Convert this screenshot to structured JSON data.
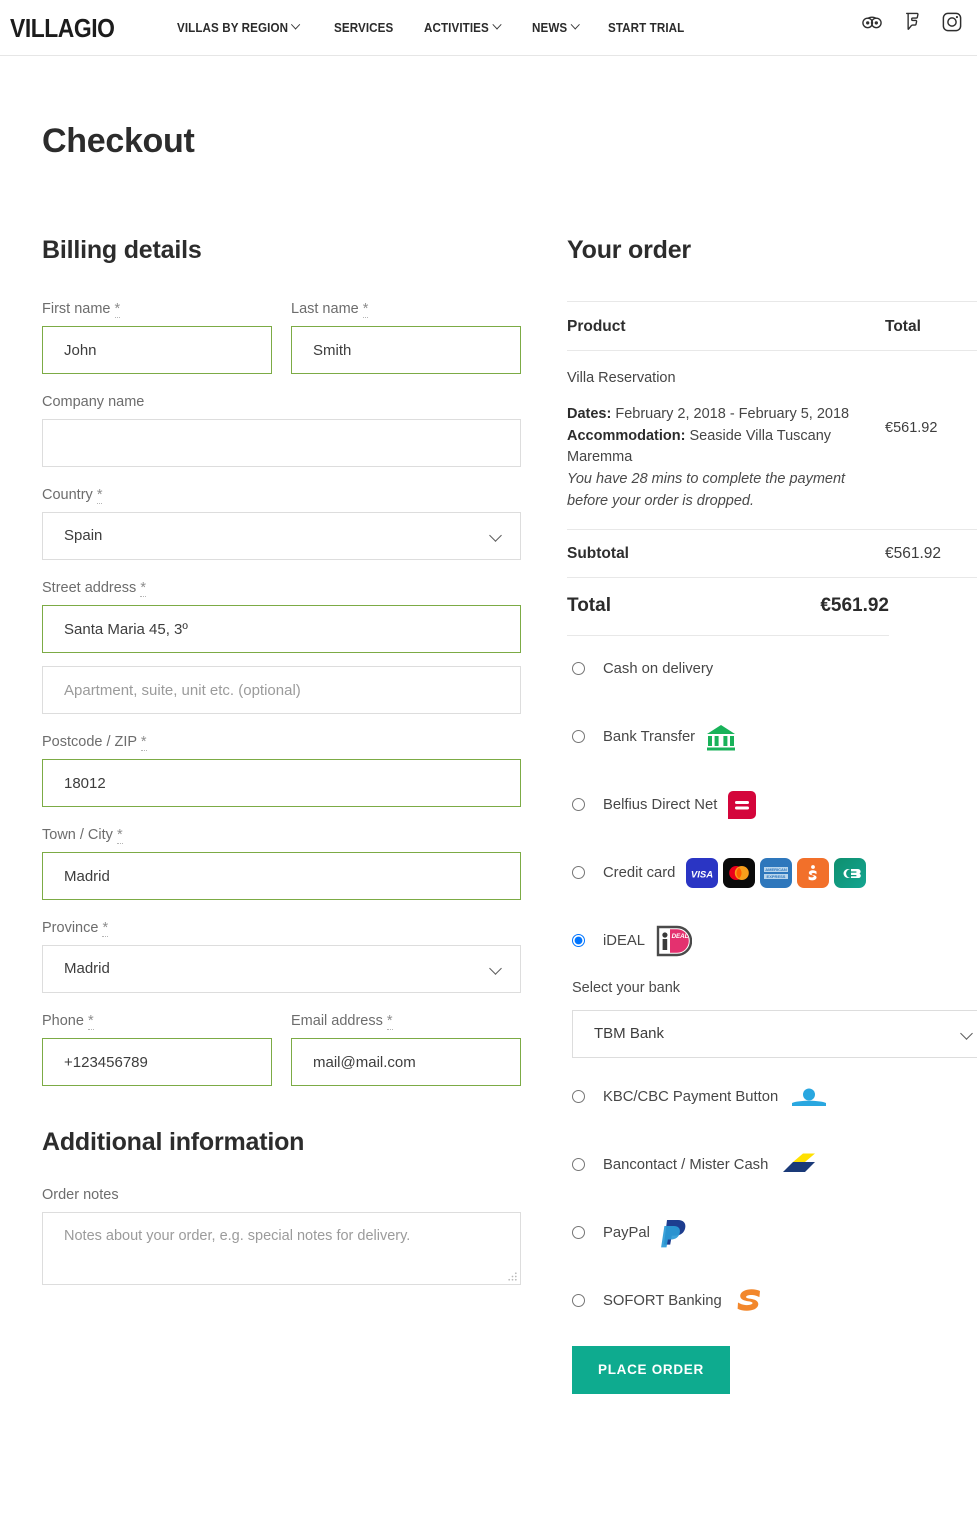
{
  "header": {
    "brand": "VILLAGIO",
    "nav": [
      {
        "label": "VILLAS BY REGION",
        "has_caret": true
      },
      {
        "label": "SERVICES",
        "has_caret": false
      },
      {
        "label": "ACTIVITIES",
        "has_caret": true
      },
      {
        "label": "NEWS",
        "has_caret": true
      },
      {
        "label": "START TRIAL",
        "has_caret": false
      }
    ],
    "social": [
      {
        "name": "tripadvisor-icon"
      },
      {
        "name": "foursquare-icon"
      },
      {
        "name": "instagram-icon"
      }
    ]
  },
  "page": {
    "title": "Checkout"
  },
  "billing": {
    "heading": "Billing details",
    "first_name": {
      "label": "First name",
      "required": "*",
      "value": "John",
      "placeholder": ""
    },
    "last_name": {
      "label": "Last name",
      "required": "*",
      "value": "Smith",
      "placeholder": ""
    },
    "company": {
      "label": "Company name",
      "required": "",
      "value": "",
      "placeholder": ""
    },
    "country": {
      "label": "Country",
      "required": "*",
      "value": "Spain"
    },
    "street": {
      "label": "Street address",
      "required": "*",
      "value": "Santa Maria 45, 3º",
      "placeholder": ""
    },
    "street2": {
      "label": "",
      "required": "",
      "value": "",
      "placeholder": "Apartment, suite, unit etc. (optional)"
    },
    "postcode": {
      "label": "Postcode / ZIP",
      "required": "*",
      "value": "18012",
      "placeholder": ""
    },
    "city": {
      "label": "Town / City",
      "required": "*",
      "value": "Madrid",
      "placeholder": ""
    },
    "province": {
      "label": "Province",
      "required": "*",
      "value": "Madrid"
    },
    "phone": {
      "label": "Phone",
      "required": "*",
      "value": "+123456789",
      "placeholder": ""
    },
    "email": {
      "label": "Email address",
      "required": "*",
      "value": "mail@mail.com",
      "placeholder": ""
    }
  },
  "additional": {
    "heading": "Additional information",
    "notes": {
      "label": "Order notes",
      "value": "",
      "placeholder": "Notes about your order, e.g. special notes for delivery."
    }
  },
  "order": {
    "heading": "Your order",
    "col_product": "Product",
    "col_total": "Total",
    "item": {
      "name": "Villa Reservation",
      "dates_label": "Dates:",
      "dates_value": "February 2, 2018 - February 5, 2018",
      "accommodation_label": "Accommodation:",
      "accommodation_value": "Seaside Villa Tuscany Maremma",
      "warning": "You have 28 mins to complete the payment before your order is dropped.",
      "price": "€561.92"
    },
    "subtotal_label": "Subtotal",
    "subtotal_value": "€561.92",
    "total_label": "Total",
    "total_value": "€561.92"
  },
  "payment": {
    "methods": [
      {
        "id": "cod",
        "label": "Cash on delivery",
        "selected": false,
        "icons": []
      },
      {
        "id": "banktransfer",
        "label": "Bank Transfer",
        "selected": false,
        "icons": [
          "bank-building-icon"
        ]
      },
      {
        "id": "belfius",
        "label": "Belfius Direct Net",
        "selected": false,
        "icons": [
          "belfius-icon"
        ]
      },
      {
        "id": "creditcard",
        "label": "Credit card",
        "selected": false,
        "icons": [
          "visa-icon",
          "mastercard-icon",
          "amex-icon",
          "discover-icon",
          "cb-icon"
        ]
      },
      {
        "id": "ideal",
        "label": "iDEAL",
        "selected": true,
        "icons": [
          "ideal-icon"
        ]
      },
      {
        "id": "kbc",
        "label": "KBC/CBC Payment Button",
        "selected": false,
        "icons": [
          "kbc-icon"
        ]
      },
      {
        "id": "bancontact",
        "label": "Bancontact / Mister Cash",
        "selected": false,
        "icons": [
          "bancontact-icon"
        ]
      },
      {
        "id": "paypal",
        "label": "PayPal",
        "selected": false,
        "icons": [
          "paypal-icon"
        ]
      },
      {
        "id": "sofort",
        "label": "SOFORT Banking",
        "selected": false,
        "icons": [
          "sofort-icon"
        ]
      }
    ],
    "bank": {
      "label": "Select your bank",
      "value": "TBM Bank"
    },
    "place_order": "PLACE ORDER"
  },
  "colors": {
    "accent": "#0eab8f",
    "valid_border": "#7cab45",
    "belfius": "#d4053b",
    "bank_green": "#18b259",
    "ideal_pink": "#e4316f",
    "sofort_orange": "#f2872c",
    "kbc_blue": "#29a7e0",
    "paypal_blue": "#1d3d8f"
  }
}
